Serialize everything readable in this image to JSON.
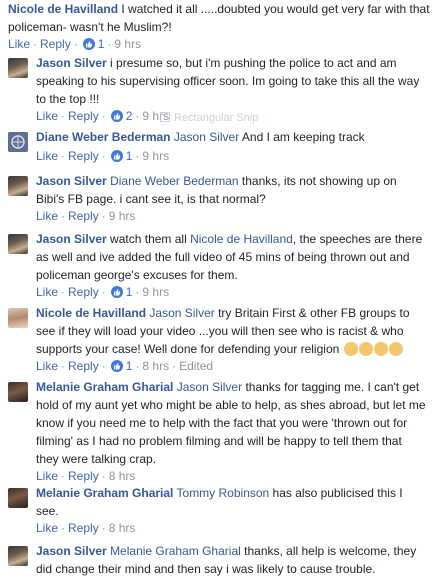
{
  "ui": {
    "like": "Like",
    "reply": "Reply"
  },
  "comments": [
    {
      "name": "Nicole de Havilland",
      "text_line1": " I watched it all .....doubted you would get very far with that",
      "text_line2": "policeman- wasn't he Muslim?!",
      "likes": "1",
      "time": "9 hrs"
    },
    {
      "name": "Jason Silver",
      "text_line1": " i presume so, but i'm pushing the police to act and am",
      "text_line2": "speaking to his supervising officer soon. Im going to take this all the way",
      "text_line3": "to the top !!!",
      "likes": "2",
      "time": "9 hrs"
    },
    {
      "name": "Diane Weber Bederman",
      "tag": "Jason Silver",
      "text_line1": " And I am keeping track",
      "likes": "1",
      "time": "9 hrs"
    },
    {
      "name": "Jason Silver",
      "tag": "Diane Weber Bederman",
      "text_line1": " thanks, its not showing up on",
      "text_line2": "Bibi's FB page. i cant see it, is that normal?",
      "time": "9 hrs"
    },
    {
      "name": "Jason Silver",
      "text_a": " watch them all ",
      "tag": "Nicole de Havilland",
      "text_b": ", the speeches are there",
      "text_line2": "as well and ive added the full video of 45 mins of being thrown out and",
      "text_line3": "policeman george's excuses for them.",
      "likes": "1",
      "time": "9 hrs"
    },
    {
      "name": "Nicole de Havilland",
      "tag": "Jason Silver",
      "text_line1": " try Britain First & other FB groups to",
      "text_line2": "see if they will load your video ...you will then see who is racist & who",
      "text_line3": "supports your case! Well done for defending your religion ",
      "likes": "1",
      "time": "8 hrs",
      "edited": "Edited"
    },
    {
      "name": "Melanie Graham Gharial",
      "tag": "Jason Silver",
      "text_line1": " thanks for tagging me. I can't get",
      "text_line2": "hold of my aunt yet who might be able to help, as shes abroad, but let me",
      "text_line3": "know if you need me to help with the fact that you were 'thrown out for",
      "text_line4": "filming' as I had no problem filming and will be happy to tell them that",
      "text_line5": "they were talking crap.",
      "time": "8 hrs"
    },
    {
      "name": "Melanie Graham Gharial",
      "tag": "Tommy Robinson",
      "text_line1": " has also publicised this I",
      "text_line2": "see.",
      "time": "8 hrs"
    },
    {
      "name": "Jason Silver",
      "tag": "Melanie Graham Gharial",
      "text_line1": " thanks, all help is welcome, they",
      "text_line2": "did change their mind and then say i was likely to cause trouble."
    }
  ],
  "overlay": {
    "snip_label": "Rectangular Snip"
  },
  "colors": {
    "link": "#365899",
    "action": "#4267b2",
    "muted": "#90949c",
    "like_badge": "#3b77e8"
  }
}
